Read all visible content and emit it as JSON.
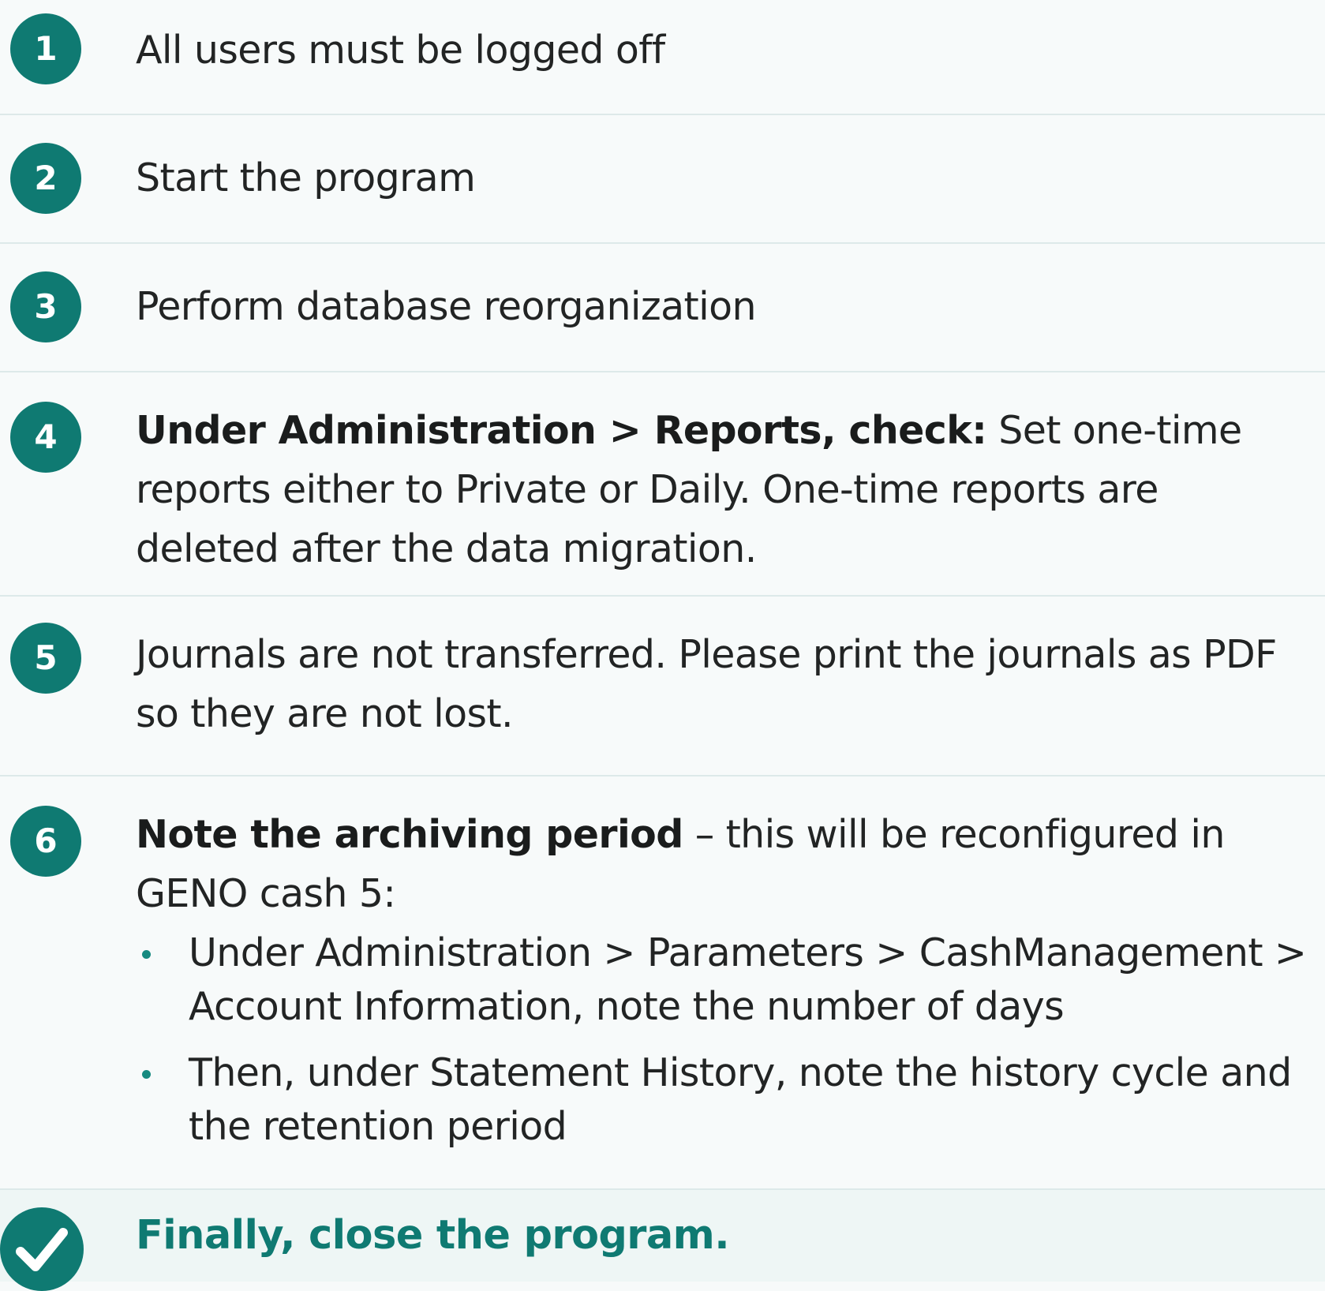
{
  "steps": [
    {
      "number": "1",
      "text": "All users must be logged off"
    },
    {
      "number": "2",
      "text": "Start the program"
    },
    {
      "number": "3",
      "text": "Perform database reorganization"
    },
    {
      "number": "4",
      "bold": "Under Administration > Reports, check:",
      "text": " Set one-time reports either to Private or Daily. One-time reports are deleted after the data migration."
    },
    {
      "number": "5",
      "text": "Journals are not transferred. Please print the journals as PDF so they are not lost."
    },
    {
      "number": "6",
      "bold": "Note the archiving period",
      "text": " – this will be reconfigured in GENO cash 5:",
      "bullets": [
        "Under Administration > Parameters > CashManagement > Account Information, note the number of days",
        "Then, under Statement History, note the history cycle and the retention period"
      ]
    }
  ],
  "final": {
    "icon": "check-icon",
    "text": "Finally, close the program."
  },
  "colors": {
    "accent": "#0f7a72",
    "background": "#f7fafa",
    "divider": "#dde9e9",
    "text": "#222424"
  }
}
